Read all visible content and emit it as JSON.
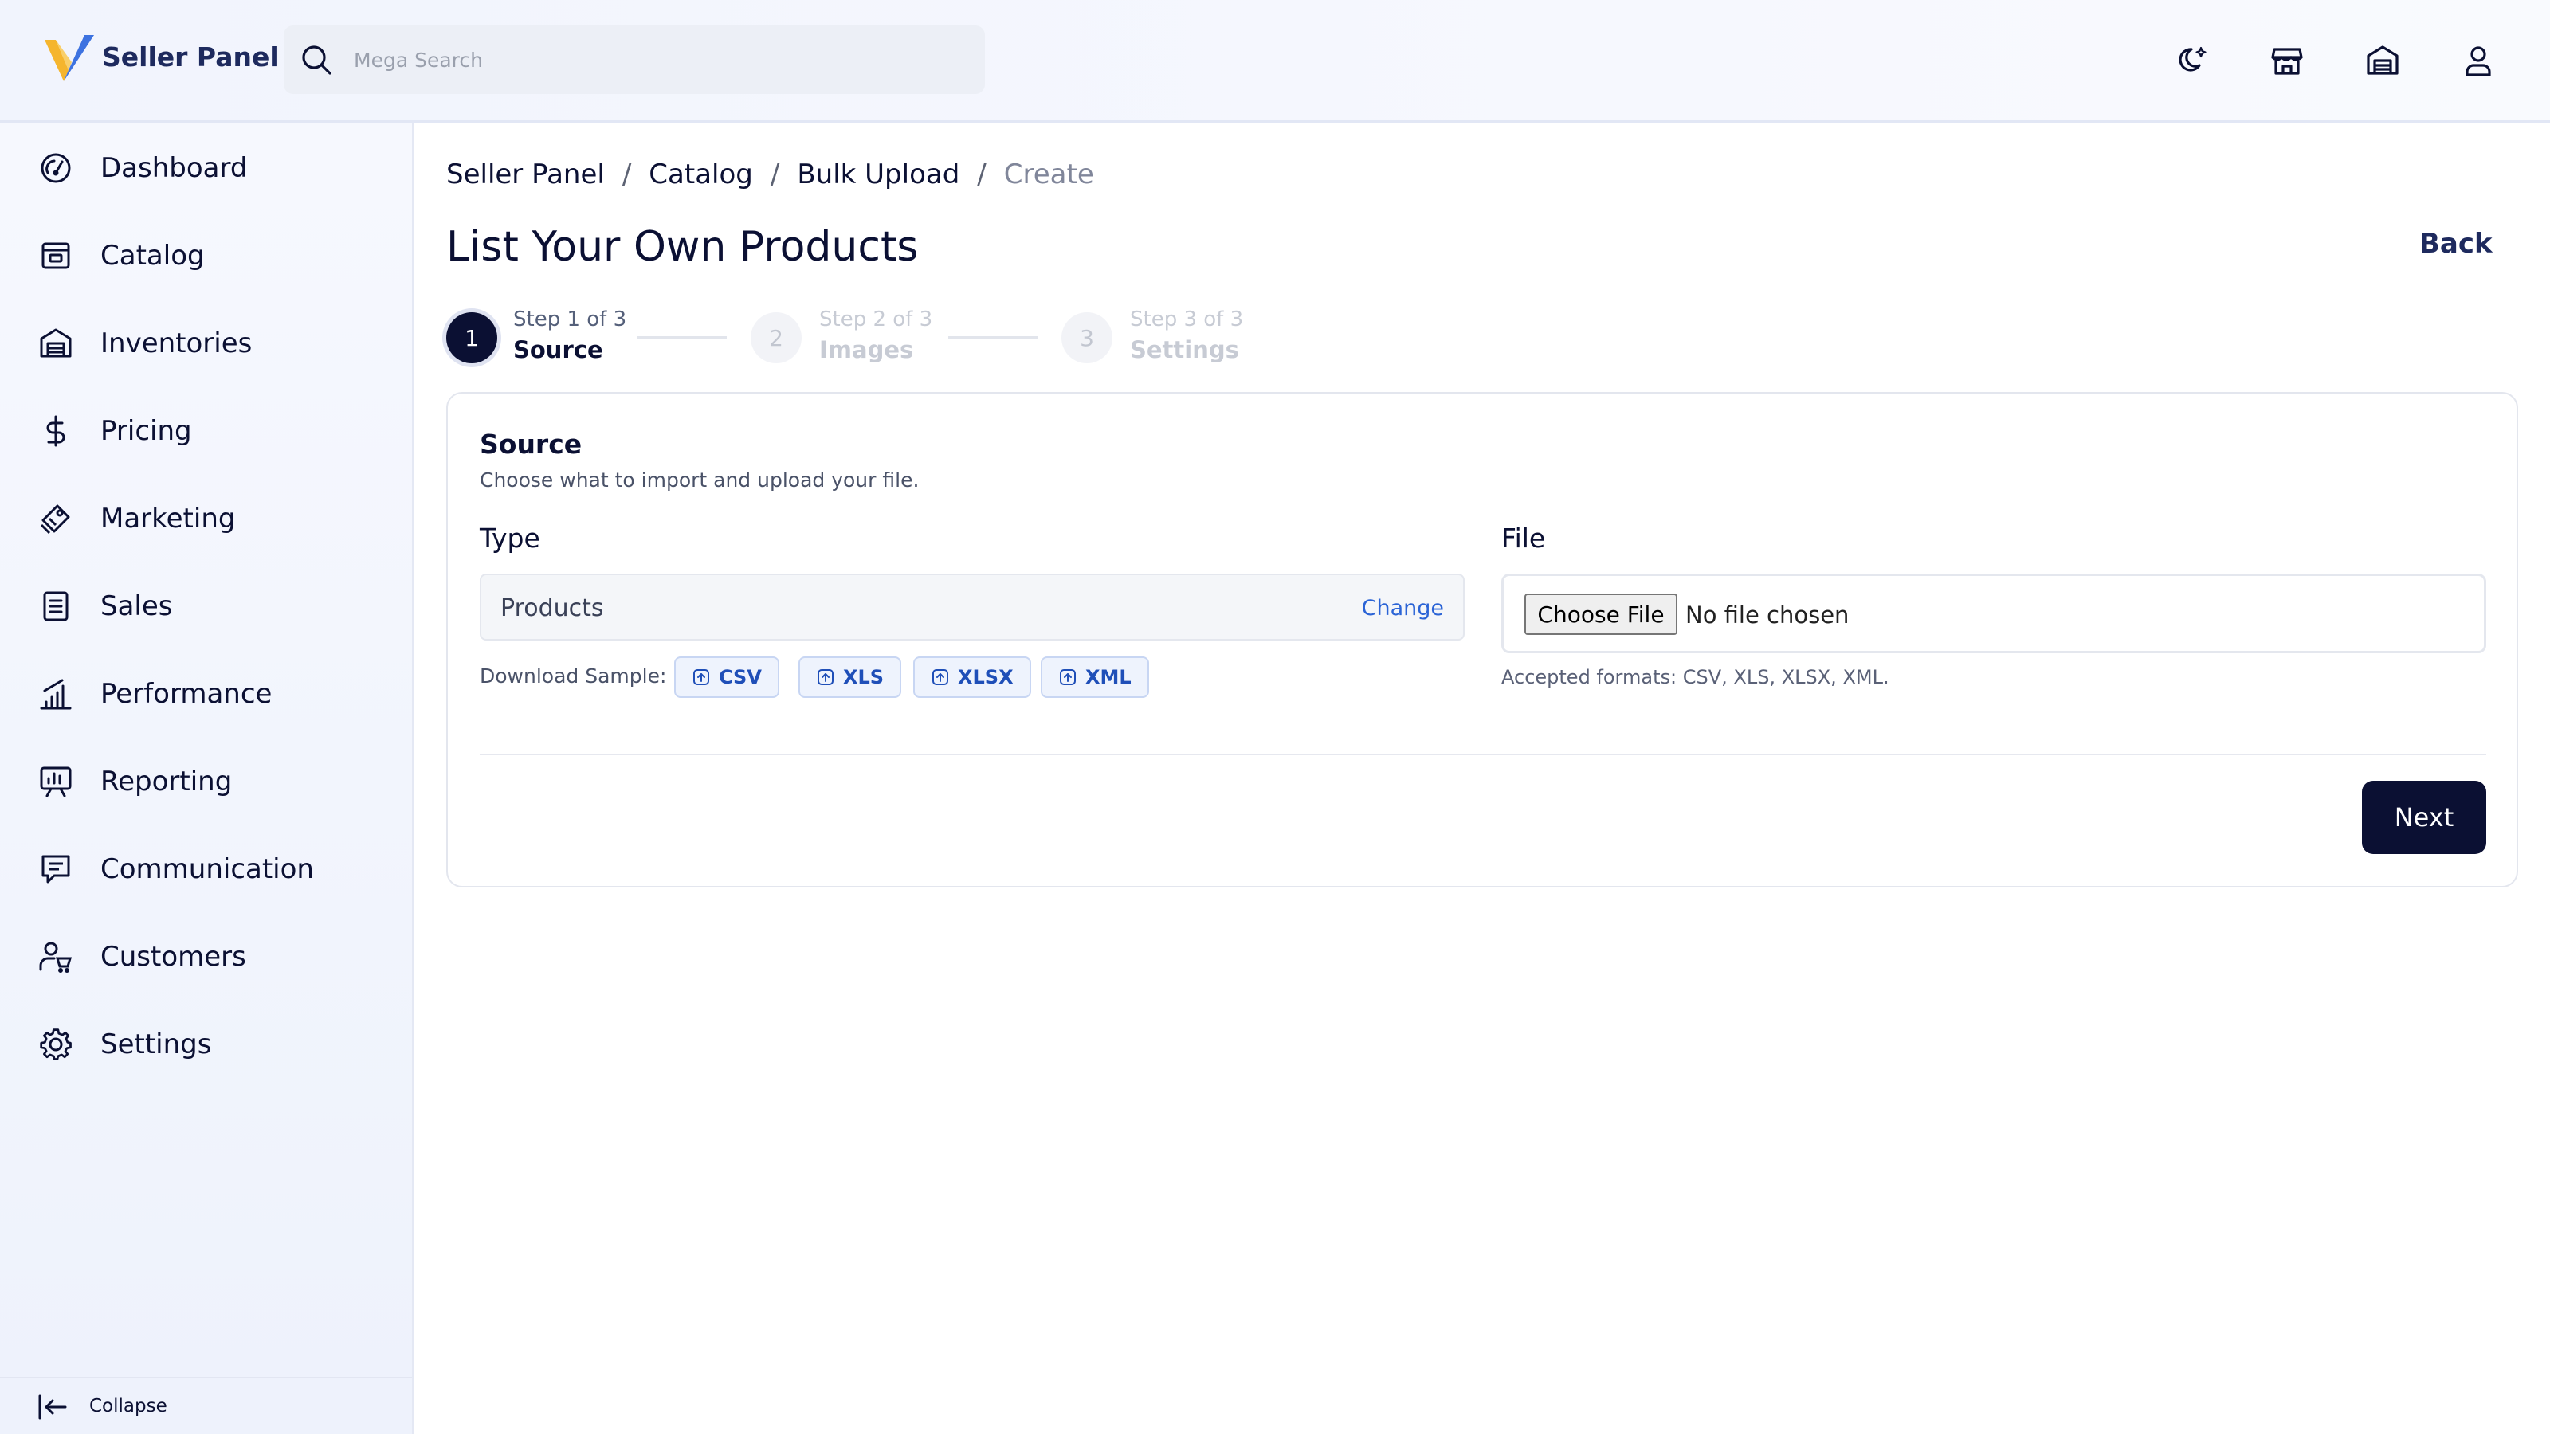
{
  "header": {
    "brand": "Seller Panel",
    "search_placeholder": "Mega Search",
    "icons": [
      "moon-star-icon",
      "store-icon",
      "warehouse-icon",
      "user-icon"
    ]
  },
  "sidebar": {
    "items": [
      {
        "label": "Dashboard",
        "icon": "gauge-icon"
      },
      {
        "label": "Catalog",
        "icon": "catalog-icon"
      },
      {
        "label": "Inventories",
        "icon": "warehouse-icon"
      },
      {
        "label": "Pricing",
        "icon": "dollar-icon"
      },
      {
        "label": "Marketing",
        "icon": "megaphone-icon"
      },
      {
        "label": "Sales",
        "icon": "receipt-icon"
      },
      {
        "label": "Performance",
        "icon": "bar-chart-icon"
      },
      {
        "label": "Reporting",
        "icon": "presentation-chart-icon"
      },
      {
        "label": "Communication",
        "icon": "message-icon"
      },
      {
        "label": "Customers",
        "icon": "customers-icon"
      },
      {
        "label": "Settings",
        "icon": "gear-icon"
      }
    ],
    "collapse_label": "Collapse"
  },
  "breadcrumb": {
    "items": [
      "Seller Panel",
      "Catalog",
      "Bulk Upload",
      "Create"
    ],
    "separator": "/"
  },
  "page": {
    "title": "List Your Own Products",
    "back_label": "Back"
  },
  "stepper": {
    "steps": [
      {
        "number": "1",
        "kicker": "Step 1 of 3",
        "name": "Source",
        "state": "active"
      },
      {
        "number": "2",
        "kicker": "Step 2 of 3",
        "name": "Images",
        "state": "inactive"
      },
      {
        "number": "3",
        "kicker": "Step 3 of 3",
        "name": "Settings",
        "state": "inactive"
      }
    ]
  },
  "source_card": {
    "title": "Source",
    "subtitle": "Choose what to import and upload your file.",
    "type_label": "Type",
    "type_value": "Products",
    "change_label": "Change",
    "download_label": "Download Sample:",
    "samples": [
      "CSV",
      "XLS",
      "XLSX",
      "XML"
    ],
    "file_label": "File",
    "choose_file_label": "Choose File",
    "file_status": "No file chosen",
    "accepted_formats": "Accepted formats: CSV, XLS, XLSX, XML.",
    "next_label": "Next"
  },
  "colors": {
    "primary": "#0b1033",
    "link": "#2b64d6",
    "brand_yellow": "#f5b52e",
    "brand_blue": "#3d72e0"
  }
}
